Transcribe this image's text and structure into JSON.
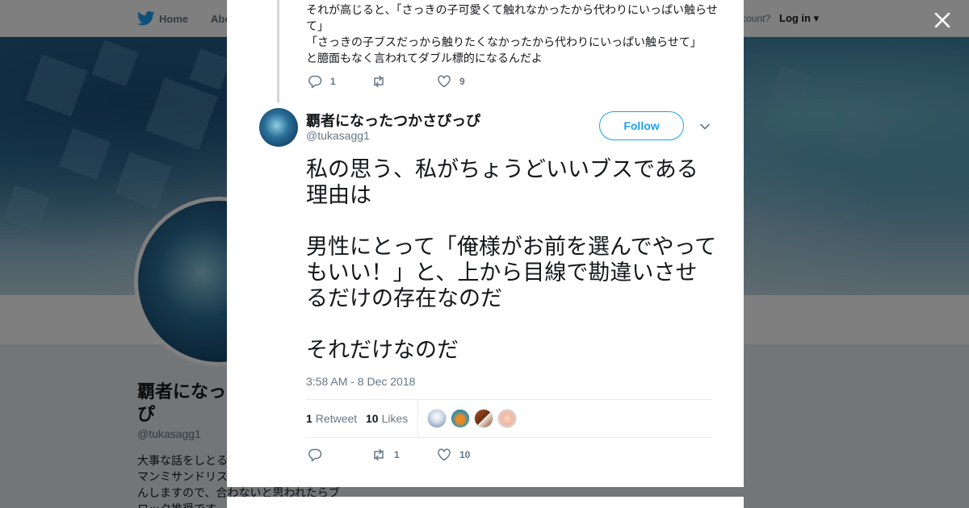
{
  "nav": {
    "home": "Home",
    "about": "Abo",
    "have_account": "ccount?",
    "login": "Log in"
  },
  "profile": {
    "name": "覇者になっ\nぴ",
    "handle": "@tukasagg1",
    "bio": "大事な話をしとる\nマンミサンドリス\nんしますので、合わないと思われたらブ\nロック推奨です"
  },
  "thread": {
    "prev_text": [
      "それが高じると、「さっきの子可愛くて触れなかったから代わりにいっぱい触らせて」",
      "「さっきの子ブスだっから触りたくなかったから代わりにいっぱい触らせて」",
      "と臆面もなく言われてダブル標的になるんだよ"
    ],
    "reply_count": "1",
    "retweet_count": "",
    "like_count": "9"
  },
  "tweet": {
    "author_name": "覇者になったつかさぴっぴ",
    "author_handle": "@tukasagg1",
    "follow_label": "Follow",
    "paragraphs": [
      "私の思う、私がちょうどいいブスである理由は",
      "男性にとって「俺様がお前を選んでやってもいい！」と、上から目線で勘違いさせるだけの存在なのだ",
      "それだけなのだ"
    ],
    "timestamp": "3:58 AM - 8 Dec 2018",
    "retweets_count": "1",
    "retweets_label": "Retweet",
    "likes_count": "10",
    "likes_label": "Likes",
    "actions": {
      "reply_count": "",
      "retweet_count": "1",
      "like_count": "10"
    }
  },
  "colors": {
    "brand": "#1da1f2",
    "muted": "#657786",
    "text": "#14171a"
  },
  "icons": [
    "twitter-bird-icon",
    "close-icon",
    "reply-icon",
    "retweet-icon",
    "heart-icon",
    "chevron-down-icon"
  ]
}
